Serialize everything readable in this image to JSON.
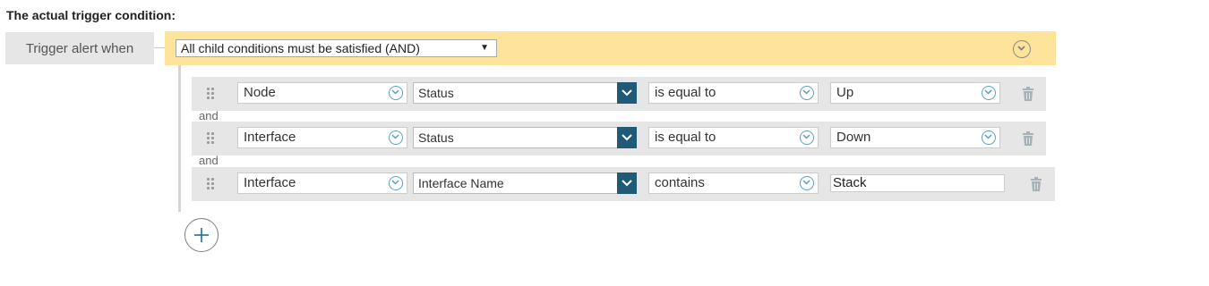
{
  "heading": "The actual trigger condition:",
  "trigger_label": "Trigger alert when",
  "logic_select": {
    "value": "All child conditions must be satisfied (AND)",
    "arrow": "▼"
  },
  "conditions": [
    {
      "object": "Node",
      "property": "Status",
      "operator": "is equal to",
      "value": "Up",
      "value_is_text_input": false
    },
    {
      "object": "Interface",
      "property": "Status",
      "operator": "is equal to",
      "value": "Down",
      "value_is_text_input": false
    },
    {
      "object": "Interface",
      "property": "Interface Name",
      "operator": "contains",
      "value": "Stack",
      "value_is_text_input": true
    }
  ],
  "joiners": [
    "and",
    "and"
  ],
  "icons": {
    "collapse": "chevron-down-circle-icon",
    "drag": "drag-handle-icon",
    "dropdown": "chevron-down-circle-icon",
    "property_dropdown": "chevron-down-icon",
    "delete": "trash-icon",
    "add": "plus-circle-icon"
  },
  "colors": {
    "header_bar": "#fde49a",
    "row_bg": "#e6e6e6",
    "label_bg": "#e6e6e6",
    "accent_dark": "#1f5a78",
    "chevron_blue": "#5a9fc7"
  }
}
